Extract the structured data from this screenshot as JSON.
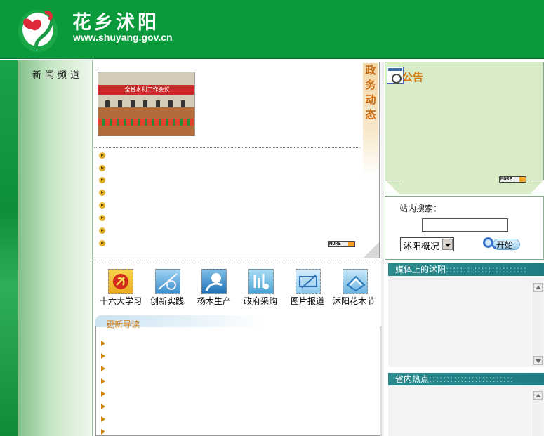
{
  "header": {
    "title": "花乡沭阳",
    "url": "www.shuyang.gov.cn",
    "logo_icon": "flower-heart-logo-icon",
    "bg_color": "#0a9a3c"
  },
  "sidebar": {
    "nav_label": "新闻频道"
  },
  "gov_news": {
    "section_label": [
      "政",
      "务",
      "动",
      "态"
    ],
    "photo_banner": "全省水利工作会议",
    "more_label": "MORE",
    "bullet_count": 8
  },
  "notice": {
    "title": "公告",
    "more_label": "MORE"
  },
  "search": {
    "label": "站内搜索：",
    "input_value": "",
    "select_value": "沭阳概况",
    "start_label": "开始"
  },
  "categories": [
    {
      "label": "十六大学习",
      "icon": "party-emblem-icon"
    },
    {
      "label": "创新实践",
      "icon": "innovation-icon"
    },
    {
      "label": "杨木生产",
      "icon": "poplar-tree-icon"
    },
    {
      "label": "政府采购",
      "icon": "procurement-icon"
    },
    {
      "label": "图片报道",
      "icon": "photo-report-icon"
    },
    {
      "label": "沭阳花木节",
      "icon": "flower-festival-icon"
    }
  ],
  "updates": {
    "title": "更新导读"
  },
  "media": {
    "title": "媒体上的沭阳",
    "dots": ":::::::::::::::::::::::"
  },
  "province": {
    "title": "省内热点",
    "dots": "::::::::::::::::::::::::"
  }
}
